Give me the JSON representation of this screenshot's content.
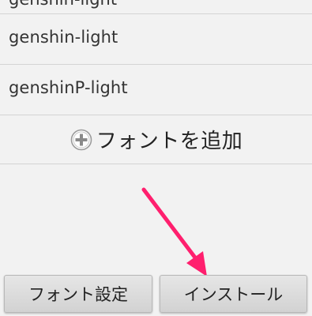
{
  "font_list": {
    "partial_item": "genshin-light",
    "items": [
      {
        "label": "genshin-light"
      },
      {
        "label": "genshinP-light"
      }
    ],
    "add_font_label": "フォントを追加",
    "add_icon": "plus-circle-icon"
  },
  "annotation": {
    "arrow_color": "#ff1f6e",
    "arrow_icon": "pointer-arrow-icon"
  },
  "buttons": {
    "font_settings_label": "フォント設定",
    "install_label": "インストール"
  }
}
